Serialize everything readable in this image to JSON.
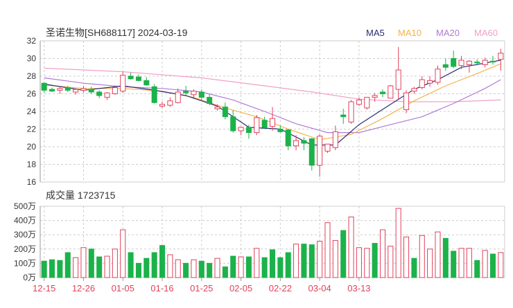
{
  "stock": {
    "title": "圣诺生物[SH688117] 2024-03-19",
    "ma_legend": [
      {
        "label": "MA5",
        "color": "#2a2a72"
      },
      {
        "label": "MA10",
        "color": "#f5b24a"
      },
      {
        "label": "MA20",
        "color": "#b07ad6"
      },
      {
        "label": "MA60",
        "color": "#f0a0c8"
      }
    ],
    "volume_label": "成交量 1723715"
  },
  "colors": {
    "up": "#e0405a",
    "down": "#1cb24a",
    "grid": "#cccccc"
  },
  "chart_data": [
    {
      "type": "candlestick",
      "title": "圣诺生物[SH688117] 2024-03-19",
      "ylim": [
        16,
        32
      ],
      "yticks": [
        "32",
        "30",
        "28",
        "26",
        "24",
        "22",
        "20",
        "18",
        "16"
      ],
      "xticks": [
        "12-15",
        "12-26",
        "01-05",
        "01-16",
        "01-25",
        "02-05",
        "02-22",
        "03-04",
        "03-13"
      ],
      "xtick_index": [
        0,
        5,
        10,
        15,
        20,
        25,
        30,
        35,
        40
      ],
      "ohlc": [
        [
          27.2,
          27.3,
          26.1,
          26.4
        ],
        [
          26.5,
          26.7,
          26.2,
          26.3
        ],
        [
          26.4,
          26.8,
          26.0,
          26.6
        ],
        [
          26.7,
          26.9,
          26.2,
          26.4
        ],
        [
          26.2,
          26.6,
          25.9,
          26.5
        ],
        [
          26.4,
          26.9,
          26.1,
          26.6
        ],
        [
          26.5,
          26.8,
          26.0,
          26.2
        ],
        [
          26.2,
          26.4,
          25.5,
          25.8
        ],
        [
          25.6,
          26.2,
          25.3,
          26.1
        ],
        [
          26.0,
          26.8,
          25.9,
          26.7
        ],
        [
          26.3,
          28.5,
          26.1,
          28.1
        ],
        [
          28.0,
          28.4,
          27.6,
          27.7
        ],
        [
          27.9,
          28.2,
          27.4,
          27.5
        ],
        [
          27.5,
          27.9,
          26.9,
          27.0
        ],
        [
          26.8,
          27.1,
          24.9,
          25.0
        ],
        [
          24.6,
          25.1,
          24.4,
          24.8
        ],
        [
          24.7,
          25.6,
          24.5,
          25.2
        ],
        [
          25.0,
          26.6,
          24.9,
          26.2
        ],
        [
          26.3,
          26.9,
          25.8,
          26.1
        ],
        [
          25.9,
          26.5,
          25.4,
          26.3
        ],
        [
          26.2,
          26.5,
          25.3,
          25.6
        ],
        [
          25.6,
          26.0,
          24.7,
          24.9
        ],
        [
          24.3,
          24.8,
          24.1,
          24.5
        ],
        [
          24.5,
          25.0,
          23.1,
          23.4
        ],
        [
          23.4,
          24.1,
          21.6,
          21.8
        ],
        [
          21.8,
          22.3,
          21.3,
          22.2
        ],
        [
          22.2,
          22.5,
          20.9,
          21.6
        ],
        [
          21.6,
          23.6,
          21.3,
          23.3
        ],
        [
          23.0,
          23.4,
          22.0,
          22.2
        ],
        [
          22.3,
          24.5,
          21.8,
          23.2
        ],
        [
          22.0,
          22.4,
          21.6,
          21.7
        ],
        [
          21.9,
          22.0,
          19.6,
          20.1
        ],
        [
          20.1,
          21.3,
          19.6,
          20.7
        ],
        [
          20.7,
          21.1,
          19.6,
          20.4
        ],
        [
          20.9,
          21.0,
          17.3,
          17.9
        ],
        [
          17.9,
          21.4,
          16.6,
          21.2
        ],
        [
          19.5,
          20.3,
          19.3,
          20.3
        ],
        [
          19.9,
          22.4,
          19.6,
          21.7
        ],
        [
          23.6,
          24.3,
          22.6,
          23.4
        ],
        [
          22.8,
          25.3,
          22.6,
          25.1
        ],
        [
          24.8,
          25.6,
          24.6,
          25.3
        ],
        [
          24.4,
          25.6,
          24.2,
          25.6
        ],
        [
          25.6,
          26.1,
          25.1,
          25.8
        ],
        [
          26.2,
          26.5,
          25.6,
          26.0
        ],
        [
          25.5,
          27.0,
          25.5,
          26.9
        ],
        [
          26.5,
          31.3,
          25.4,
          28.7
        ],
        [
          24.2,
          26.4,
          23.8,
          26.1
        ],
        [
          26.3,
          26.8,
          26.0,
          26.6
        ],
        [
          26.7,
          28.0,
          26.5,
          27.6
        ],
        [
          27.2,
          28.0,
          26.8,
          27.5
        ],
        [
          27.3,
          29.2,
          27.0,
          28.8
        ],
        [
          29.3,
          30.0,
          28.6,
          29.0
        ],
        [
          30.0,
          30.9,
          28.9,
          29.1
        ],
        [
          29.2,
          30.3,
          28.8,
          29.8
        ],
        [
          29.3,
          29.8,
          28.4,
          29.7
        ],
        [
          29.6,
          29.9,
          29.2,
          29.5
        ],
        [
          29.3,
          30.1,
          29.0,
          29.8
        ],
        [
          29.7,
          30.3,
          29.3,
          29.6
        ],
        [
          29.9,
          31.1,
          28.6,
          30.6
        ]
      ],
      "ma": {
        "MA5": [
          [
            0,
            27.1
          ],
          [
            5,
            26.4
          ],
          [
            10,
            26.9
          ],
          [
            14,
            26.4
          ],
          [
            18,
            25.8
          ],
          [
            22,
            24.6
          ],
          [
            26,
            22.2
          ],
          [
            30,
            22.0
          ],
          [
            34,
            20.2
          ],
          [
            37,
            20.2
          ],
          [
            40,
            22.5
          ],
          [
            44,
            24.8
          ],
          [
            47,
            26.5
          ],
          [
            50,
            27.6
          ],
          [
            53,
            29.0
          ],
          [
            58,
            29.8
          ]
        ],
        "MA10": [
          [
            0,
            27.0
          ],
          [
            5,
            26.6
          ],
          [
            10,
            26.6
          ],
          [
            15,
            26.3
          ],
          [
            19,
            25.6
          ],
          [
            23,
            24.4
          ],
          [
            27,
            23.4
          ],
          [
            31,
            22.0
          ],
          [
            35,
            20.8
          ],
          [
            39,
            21.4
          ],
          [
            43,
            23.2
          ],
          [
            47,
            25.2
          ],
          [
            51,
            26.9
          ],
          [
            55,
            28.3
          ],
          [
            58,
            29.4
          ]
        ],
        "MA20": [
          [
            0,
            27.8
          ],
          [
            5,
            27.2
          ],
          [
            10,
            26.8
          ],
          [
            15,
            26.6
          ],
          [
            20,
            26.2
          ],
          [
            24,
            25.3
          ],
          [
            28,
            24.0
          ],
          [
            32,
            22.6
          ],
          [
            36,
            21.6
          ],
          [
            40,
            21.6
          ],
          [
            44,
            22.5
          ],
          [
            48,
            23.4
          ],
          [
            52,
            24.9
          ],
          [
            56,
            26.6
          ],
          [
            58,
            27.6
          ]
        ],
        "MA60": [
          [
            0,
            28.9
          ],
          [
            10,
            28.5
          ],
          [
            20,
            27.8
          ],
          [
            28,
            26.9
          ],
          [
            34,
            26.2
          ],
          [
            40,
            25.4
          ],
          [
            46,
            25.1
          ],
          [
            52,
            25.1
          ],
          [
            58,
            25.3
          ]
        ]
      }
    },
    {
      "type": "bar",
      "title": "成交量 1723715",
      "ylabel": "万",
      "ylim": [
        0,
        500
      ],
      "yticks": [
        "500万",
        "400万",
        "300万",
        "200万",
        "100万",
        "0万"
      ],
      "values": [
        115,
        125,
        120,
        175,
        140,
        210,
        200,
        145,
        150,
        200,
        335,
        175,
        100,
        135,
        175,
        225,
        160,
        125,
        100,
        125,
        115,
        100,
        135,
        75,
        150,
        145,
        145,
        205,
        140,
        195,
        140,
        175,
        235,
        235,
        230,
        255,
        385,
        260,
        330,
        425,
        210,
        205,
        240,
        335,
        220,
        485,
        285,
        135,
        295,
        200,
        320,
        275,
        185,
        205,
        205,
        120,
        190,
        165,
        175
      ],
      "up": [
        0,
        0,
        0,
        0,
        1,
        1,
        0,
        0,
        1,
        1,
        1,
        0,
        0,
        0,
        0,
        0,
        1,
        1,
        0,
        1,
        0,
        0,
        1,
        0,
        0,
        1,
        0,
        1,
        0,
        0,
        0,
        0,
        1,
        0,
        0,
        1,
        1,
        1,
        0,
        1,
        1,
        1,
        0,
        1,
        1,
        1,
        1,
        0,
        1,
        1,
        1,
        0,
        0,
        1,
        1,
        0,
        1,
        0,
        1
      ]
    }
  ]
}
